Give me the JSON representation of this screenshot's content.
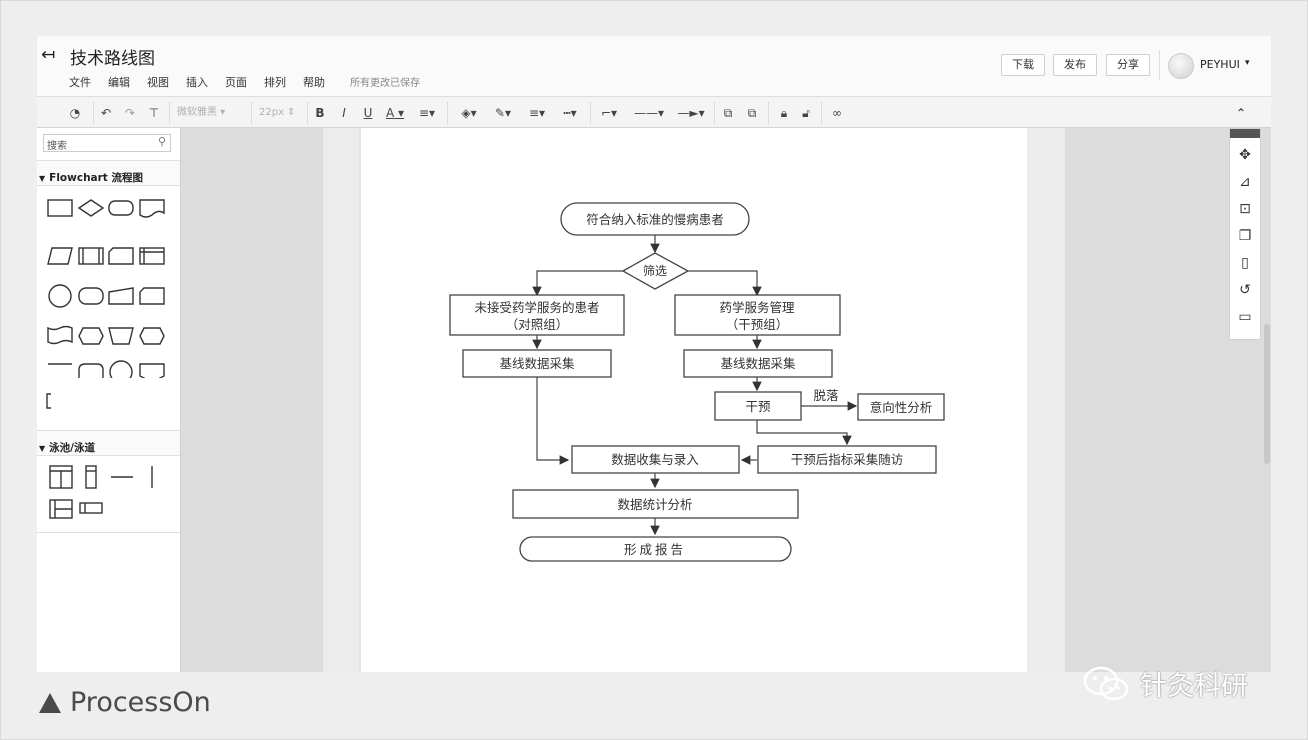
{
  "app": {
    "title": "技术路线图",
    "menu": [
      "文件",
      "编辑",
      "视图",
      "插入",
      "页面",
      "排列",
      "帮助"
    ],
    "save_status": "所有更改已保存",
    "buttons": {
      "download": "下载",
      "publish": "发布",
      "share": "分享"
    },
    "user": "PEYHUI"
  },
  "toolbar": {
    "font_family": "微软雅黑",
    "font_size": "22px",
    "bold": "B",
    "italic": "I",
    "underline": "U",
    "font_color": "A"
  },
  "sidebar": {
    "search_placeholder": "搜索",
    "sections": [
      "Flowchart 流程图",
      "泳池/泳道"
    ]
  },
  "flowchart": {
    "start": "符合纳入标准的慢病患者",
    "decision": "筛选",
    "left_group_line1": "未接受药学服务的患者",
    "left_group_line2": "（对照组）",
    "right_group_line1": "药学服务管理",
    "right_group_line2": "（干预组）",
    "left_baseline": "基线数据采集",
    "right_baseline": "基线数据采集",
    "intervention": "干预",
    "dropout_label": "脱落",
    "intent_analysis": "意向性分析",
    "followup": "干预后指标采集随访",
    "data_entry": "数据收集与录入",
    "statistics": "数据统计分析",
    "report": "形成报告"
  },
  "footer": {
    "brand": "ProcessOn",
    "watermark": "针灸科研"
  }
}
